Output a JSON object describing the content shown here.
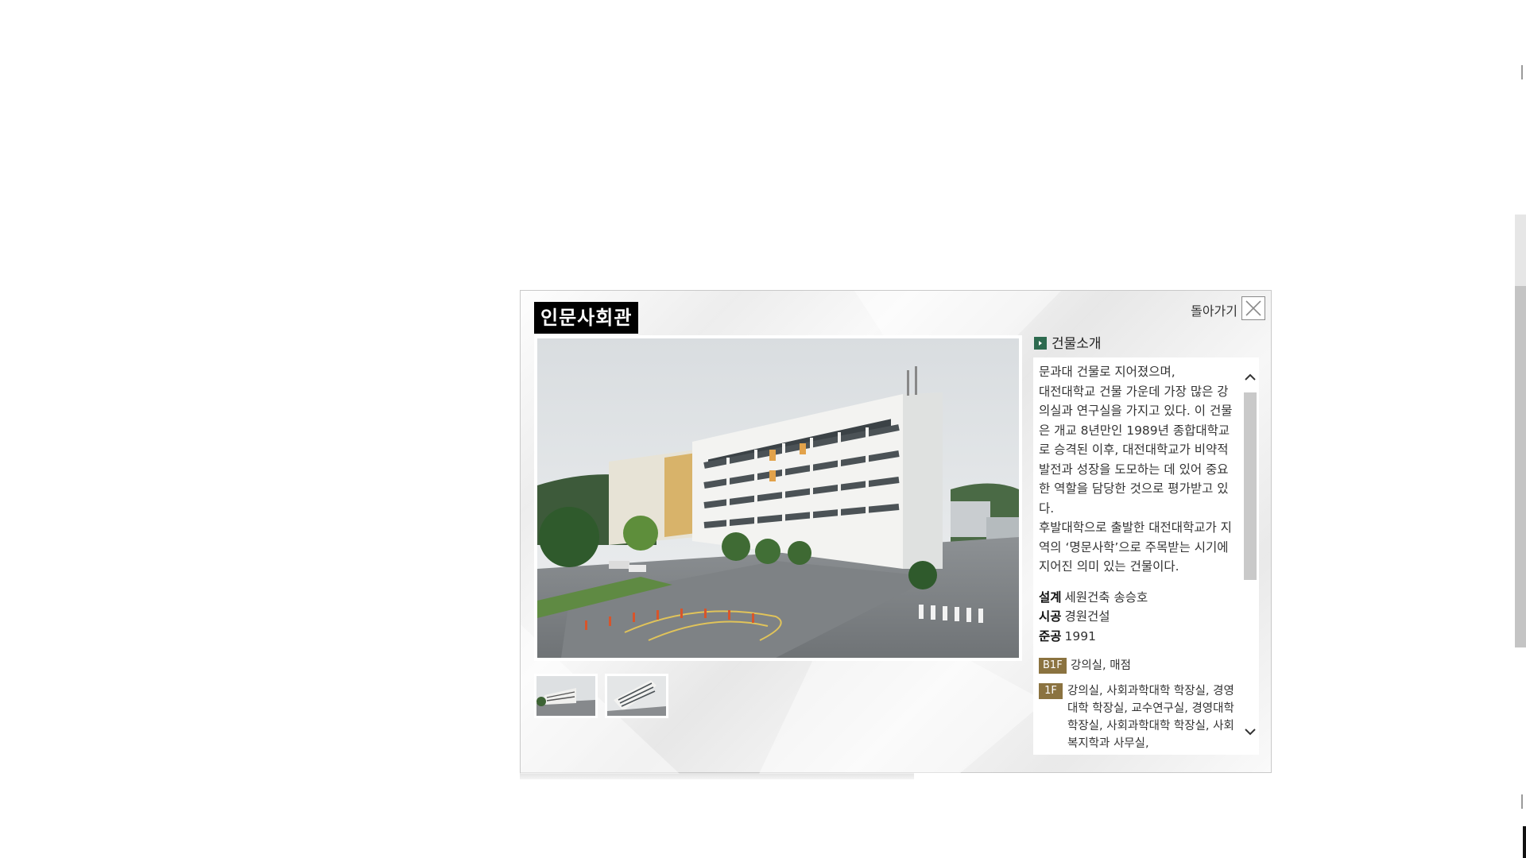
{
  "modal": {
    "title": "인문사회관",
    "back_label": "돌아가기",
    "section_title": "건물소개",
    "description": "문과대 건물로 지어졌으며,\n대전대학교 건물 가운데 가장 많은 강의실과 연구실을 가지고 있다. 이 건물은 개교 8년만인 1989년 종합대학교로 승격된 이후, 대전대학교가 비약적 발전과 성장을 도모하는 데 있어 중요한 역할을 담당한 것으로 평가받고 있다.\n후발대학으로 출발한 대전대학교가 지역의 ‘명문사학’으로 주목받는 시기에 지어진 의미 있는 건물이다.",
    "specs": [
      {
        "key": "설계",
        "value": "세원건축 송승호"
      },
      {
        "key": "시공",
        "value": "경원건설"
      },
      {
        "key": "준공",
        "value": "1991"
      }
    ],
    "floors": [
      {
        "level": "B1F",
        "rooms": "강의실, 매점"
      },
      {
        "level": "1F",
        "rooms": "강의실, 사회과학대학 학장실, 경영대학 학장실, 교수연구실, 경영대학 학장실, 사회과학대학 학장실, 사회복지학과 사무실,"
      }
    ]
  },
  "colors": {
    "title_bg": "#000000",
    "section_icon": "#2d6a4f",
    "floor_badge": "#8b7340"
  },
  "icons": {
    "close": "close-icon",
    "section": "arrow-right-icon",
    "scroll_up": "chevron-up-icon",
    "scroll_down": "chevron-down-icon"
  }
}
